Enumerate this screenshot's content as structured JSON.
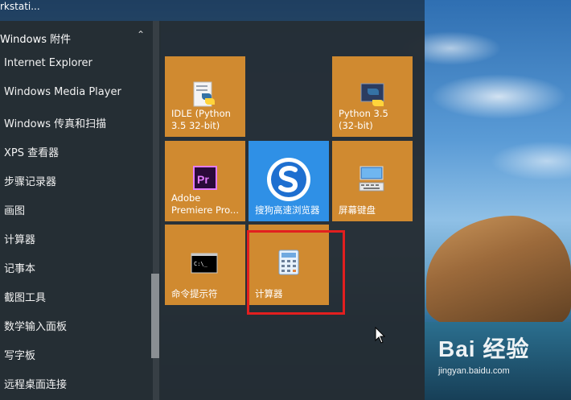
{
  "top_text": "rkstati...",
  "app_list": {
    "group_header": "Windows 附件",
    "items": [
      {
        "label": "Internet Explorer"
      },
      {
        "label": "Windows Media Player"
      },
      {
        "label": "Windows 传真和扫描"
      },
      {
        "label": "XPS 查看器"
      },
      {
        "label": "步骤记录器"
      },
      {
        "label": "画图"
      },
      {
        "label": "计算器"
      },
      {
        "label": "记事本"
      },
      {
        "label": "截图工具"
      },
      {
        "label": "数学输入面板"
      },
      {
        "label": "写字板"
      },
      {
        "label": "远程桌面连接"
      }
    ]
  },
  "tiles": [
    {
      "label": "IDLE (Python 3.5 32-bit)",
      "icon": "python-idle-icon"
    },
    {
      "label": "Python 3.5 (32-bit)",
      "icon": "python-icon"
    },
    {
      "label": "Adobe Premiere Pro...",
      "icon": "premiere-pro-icon"
    },
    {
      "label": "搜狗高速浏览器",
      "icon": "sogou-browser-icon"
    },
    {
      "label": "屏幕键盘",
      "icon": "on-screen-keyboard-icon"
    },
    {
      "label": "命令提示符",
      "icon": "command-prompt-icon"
    },
    {
      "label": "计算器",
      "icon": "calculator-icon"
    }
  ],
  "watermark": {
    "main": "Bai 经验",
    "sub": "jingyan.baidu.com"
  },
  "colors": {
    "tile_orange": "#d08a30",
    "tile_blue": "#2f90e6",
    "highlight_red": "#e21f1f"
  }
}
